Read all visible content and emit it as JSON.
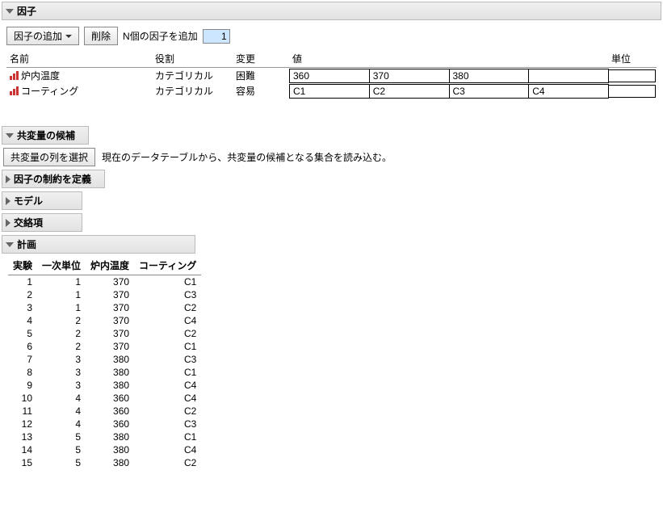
{
  "factors": {
    "title": "因子",
    "toolbar": {
      "add_label": "因子の追加",
      "delete_label": "削除",
      "n_add_label": "N個の因子を追加",
      "n_add_value": "1"
    },
    "columns": {
      "name": "名前",
      "role": "役割",
      "change": "変更",
      "values": "値",
      "unit": "単位"
    },
    "rows": [
      {
        "name": "炉内温度",
        "role": "カテゴリカル",
        "change": "困難",
        "values": [
          "360",
          "370",
          "380",
          ""
        ],
        "unit": ""
      },
      {
        "name": "コーティング",
        "role": "カテゴリカル",
        "change": "容易",
        "values": [
          "C1",
          "C2",
          "C3",
          "C4"
        ],
        "unit": ""
      }
    ]
  },
  "covariate": {
    "title": "共変量の候補",
    "button": "共変量の列を選択",
    "hint": "現在のデータテーブルから、共変量の候補となる集合を読み込む。"
  },
  "constraints": {
    "title": "因子の制約を定義"
  },
  "model": {
    "title": "モデル"
  },
  "alias": {
    "title": "交絡項"
  },
  "design": {
    "title": "計画",
    "columns": {
      "run": "実験",
      "wp": "一次単位",
      "temp": "炉内温度",
      "coating": "コーティング"
    },
    "rows": [
      {
        "run": 1,
        "wp": 1,
        "temp": 370,
        "coating": "C1"
      },
      {
        "run": 2,
        "wp": 1,
        "temp": 370,
        "coating": "C3"
      },
      {
        "run": 3,
        "wp": 1,
        "temp": 370,
        "coating": "C2"
      },
      {
        "run": 4,
        "wp": 2,
        "temp": 370,
        "coating": "C4"
      },
      {
        "run": 5,
        "wp": 2,
        "temp": 370,
        "coating": "C2"
      },
      {
        "run": 6,
        "wp": 2,
        "temp": 370,
        "coating": "C1"
      },
      {
        "run": 7,
        "wp": 3,
        "temp": 380,
        "coating": "C3"
      },
      {
        "run": 8,
        "wp": 3,
        "temp": 380,
        "coating": "C1"
      },
      {
        "run": 9,
        "wp": 3,
        "temp": 380,
        "coating": "C4"
      },
      {
        "run": 10,
        "wp": 4,
        "temp": 360,
        "coating": "C4"
      },
      {
        "run": 11,
        "wp": 4,
        "temp": 360,
        "coating": "C2"
      },
      {
        "run": 12,
        "wp": 4,
        "temp": 360,
        "coating": "C3"
      },
      {
        "run": 13,
        "wp": 5,
        "temp": 380,
        "coating": "C1"
      },
      {
        "run": 14,
        "wp": 5,
        "temp": 380,
        "coating": "C4"
      },
      {
        "run": 15,
        "wp": 5,
        "temp": 380,
        "coating": "C2"
      }
    ]
  }
}
